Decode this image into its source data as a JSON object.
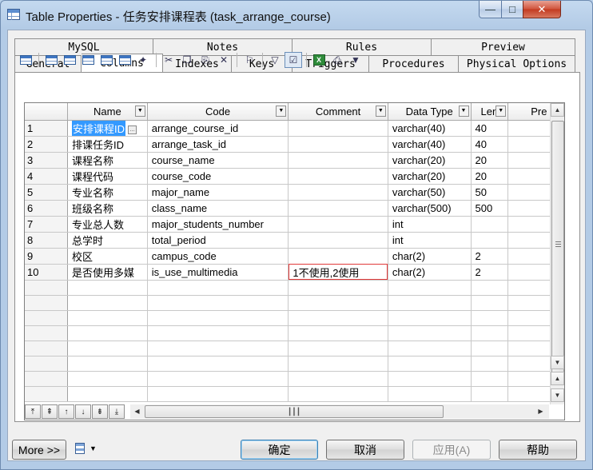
{
  "window": {
    "title": "Table Properties - 任务安排课程表 (task_arrange_course)",
    "controls": {
      "minimize": "—",
      "maximize": "□",
      "close": "✕"
    }
  },
  "tabs": {
    "row1": [
      "MySQL",
      "Notes",
      "Rules",
      "Preview"
    ],
    "row2": [
      "General",
      "Columns",
      "Indexes",
      "Keys",
      "Triggers",
      "Procedures",
      "Physical Options"
    ],
    "active": "Columns"
  },
  "toolbar": {
    "icons": [
      "properties-icon",
      "insert-row-icon",
      "add-row-icon",
      "add-multiple-icon",
      "grid-icon",
      "customize-icon",
      "cut-icon",
      "copy-icon",
      "paste-icon",
      "delete-icon",
      "find-icon",
      "filter-icon",
      "customize-columns-icon",
      "excel-icon",
      "print-icon",
      "dropdown-arrow-icon"
    ]
  },
  "grid": {
    "columns": [
      "Name",
      "Code",
      "Comment",
      "Data Type",
      "Len",
      "Pre"
    ],
    "rows": [
      {
        "num": "1",
        "name": "安排课程ID",
        "code": "arrange_course_id",
        "comment": "",
        "type": "varchar(40)",
        "len": "40"
      },
      {
        "num": "2",
        "name": "排课任务ID",
        "code": "arrange_task_id",
        "comment": "",
        "type": "varchar(40)",
        "len": "40"
      },
      {
        "num": "3",
        "name": "课程名称",
        "code": "course_name",
        "comment": "",
        "type": "varchar(20)",
        "len": "20"
      },
      {
        "num": "4",
        "name": "课程代码",
        "code": "course_code",
        "comment": "",
        "type": "varchar(20)",
        "len": "20"
      },
      {
        "num": "5",
        "name": "专业名称",
        "code": "major_name",
        "comment": "",
        "type": "varchar(50)",
        "len": "50"
      },
      {
        "num": "6",
        "name": "班级名称",
        "code": "class_name",
        "comment": "",
        "type": "varchar(500)",
        "len": "500"
      },
      {
        "num": "7",
        "name": "专业总人数",
        "code": "major_students_number",
        "comment": "",
        "type": "int",
        "len": ""
      },
      {
        "num": "8",
        "name": "总学时",
        "code": "total_period",
        "comment": "",
        "type": "int",
        "len": ""
      },
      {
        "num": "9",
        "name": "校区",
        "code": "campus_code",
        "comment": "",
        "type": "char(2)",
        "len": "2"
      },
      {
        "num": "10",
        "name": "是否使用多媒",
        "code": "is_use_multimedia",
        "comment": "1不使用,2使用",
        "type": "char(2)",
        "len": "2"
      }
    ],
    "empty_rows": 8,
    "selected_row": 1
  },
  "footer": {
    "more_label": "More >>",
    "ok_label": "确定",
    "cancel_label": "取消",
    "apply_label": "应用(A)",
    "help_label": "帮助"
  },
  "colors": {
    "selection": "#3399ff",
    "edit_outline": "#e03a3a",
    "title_bar": "#c4d9ef"
  }
}
